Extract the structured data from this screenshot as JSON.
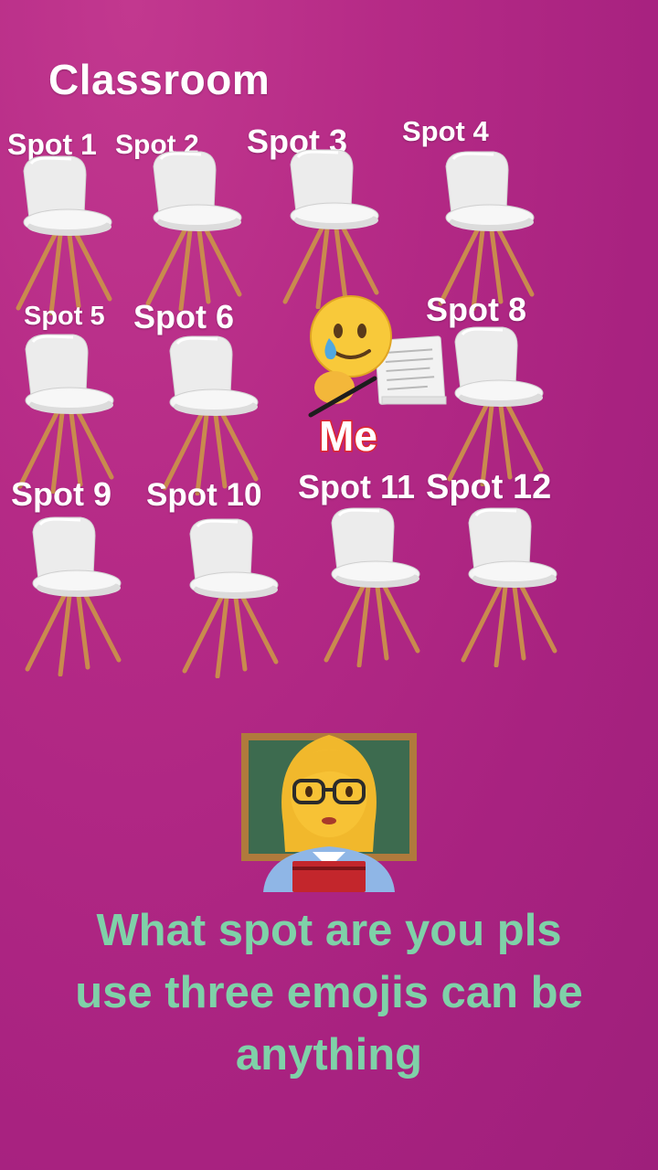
{
  "title": "Classroom",
  "spots": [
    "Spot 1",
    "Spot 2",
    "Spot 3",
    "Spot 4",
    "Spot 5",
    "Spot 6",
    "Spot 8",
    "Spot 9",
    "Spot 10",
    "Spot 11",
    "Spot 12"
  ],
  "me_label": "Me",
  "question": "What spot are you pls use three emojis can be anything",
  "colors": {
    "background": "#b02a86",
    "question_text": "#7fd1a8",
    "me_outline": "#e0282e"
  },
  "icons": [
    "chair-icon",
    "crying-smile-emoji-icon",
    "teacher-emoji-icon"
  ]
}
